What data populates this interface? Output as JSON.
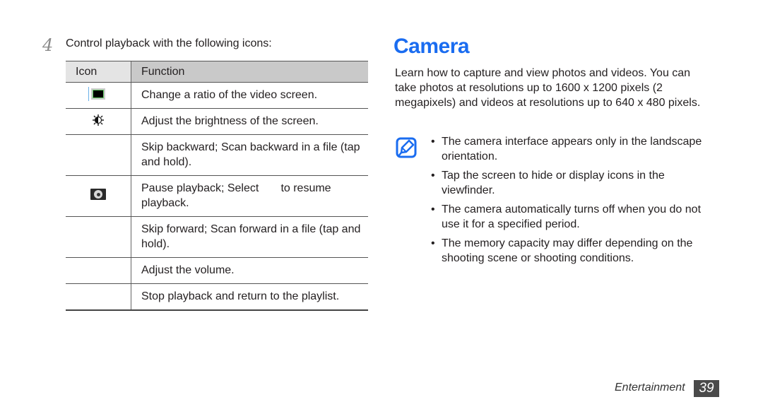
{
  "left": {
    "step_number": "4",
    "step_text": "Control playback with the following icons:",
    "table": {
      "headers": [
        "Icon",
        "Function"
      ],
      "rows": [
        {
          "icon": "aspect-ratio-icon",
          "function": "Change a ratio of the video screen."
        },
        {
          "icon": "brightness-icon",
          "function": "Adjust the brightness of the screen."
        },
        {
          "icon": "",
          "function": "Skip backward; Scan backward in a file (tap and hold)."
        },
        {
          "icon": "pause-icon",
          "function": "Pause playback; Select       to resume playback."
        },
        {
          "icon": "",
          "function": "Skip forward; Scan forward in a file (tap and hold)."
        },
        {
          "icon": "",
          "function": "Adjust the volume."
        },
        {
          "icon": "",
          "function": "Stop playback and return to the playlist."
        }
      ]
    }
  },
  "right": {
    "title": "Camera",
    "title_color": "#1a6cf0",
    "intro": "Learn how to capture and view photos and videos. You can take photos at resolutions up to 1600 x 1200 pixels (2 megapixels) and videos at resolutions up to 640 x 480 pixels.",
    "note_icon": "note-pencil-icon",
    "bullets": [
      "The camera interface appears only in the landscape orientation.",
      "Tap the screen to hide or display icons in the viewfinder.",
      "The camera automatically turns off when you do not use it for a specified period.",
      "The memory capacity may differ depending on the shooting scene or shooting conditions."
    ]
  },
  "footer": {
    "section": "Entertainment",
    "page": "39"
  }
}
